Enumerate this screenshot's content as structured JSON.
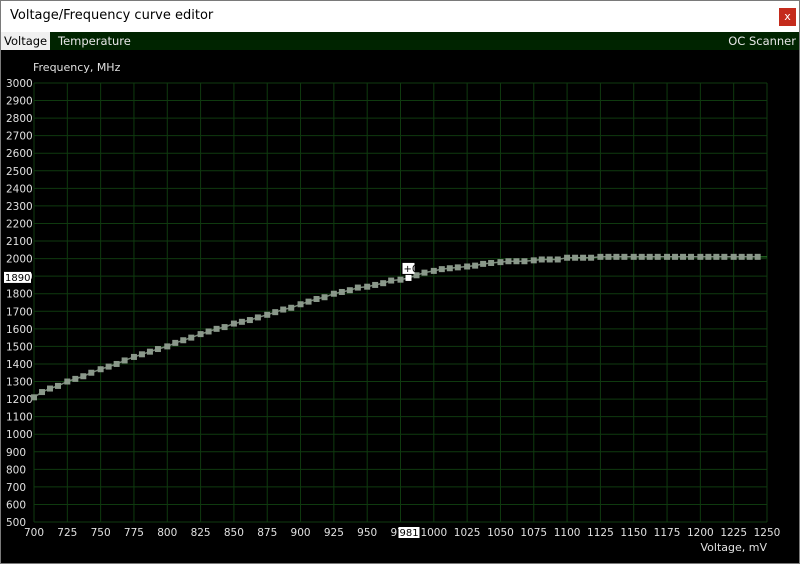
{
  "window": {
    "title": "Voltage/Frequency curve editor",
    "close_label": "x"
  },
  "tabs": [
    {
      "label": "Voltage",
      "active": true
    },
    {
      "label": "Temperature",
      "active": false
    }
  ],
  "scanner_label": "OC Scanner",
  "colors": {
    "background": "#000000",
    "grid": "#0f3a0f",
    "curve": "#7a8a7a",
    "points": "#8a988a",
    "selected": "#ffffff",
    "tab_bar": "#002400"
  },
  "chart_data": {
    "type": "line",
    "ylabel": "Frequency, MHz",
    "xlabel": "Voltage, mV",
    "xlim": [
      700,
      1250
    ],
    "ylim": [
      500,
      3000
    ],
    "x_ticks": [
      700,
      725,
      750,
      775,
      800,
      825,
      850,
      875,
      900,
      925,
      950,
      975,
      1000,
      1025,
      1050,
      1075,
      1100,
      1125,
      1150,
      1175,
      1200,
      1225,
      1250
    ],
    "y_ticks": [
      500,
      600,
      700,
      800,
      900,
      1000,
      1100,
      1200,
      1300,
      1400,
      1500,
      1600,
      1700,
      1800,
      1900,
      2000,
      2100,
      2200,
      2300,
      2400,
      2500,
      2600,
      2700,
      2800,
      2900,
      3000
    ],
    "grid": true,
    "series": [
      {
        "x": [
          700,
          706,
          712,
          718,
          725,
          731,
          737,
          743,
          750,
          756,
          762,
          768,
          775,
          781,
          787,
          793,
          800,
          806,
          812,
          818,
          825,
          831,
          837,
          843,
          850,
          856,
          862,
          868,
          875,
          881,
          887,
          893,
          900,
          906,
          912,
          918,
          925,
          931,
          937,
          943,
          950,
          956,
          962,
          968,
          975,
          981,
          987,
          993,
          1000,
          1006,
          1012,
          1018,
          1025,
          1031,
          1037,
          1043,
          1050,
          1056,
          1062,
          1068,
          1075,
          1081,
          1087,
          1093,
          1100,
          1106,
          1112,
          1118,
          1125,
          1131,
          1137,
          1143,
          1150,
          1156,
          1162,
          1168,
          1175,
          1181,
          1187,
          1193,
          1200,
          1206,
          1212,
          1218,
          1225,
          1231,
          1237,
          1243
        ],
        "y": [
          1210,
          1240,
          1260,
          1275,
          1300,
          1315,
          1330,
          1350,
          1370,
          1385,
          1400,
          1420,
          1440,
          1455,
          1470,
          1485,
          1500,
          1520,
          1535,
          1550,
          1570,
          1585,
          1600,
          1610,
          1630,
          1640,
          1650,
          1665,
          1680,
          1695,
          1710,
          1720,
          1740,
          1755,
          1770,
          1780,
          1800,
          1810,
          1820,
          1835,
          1840,
          1850,
          1860,
          1875,
          1880,
          1890,
          1905,
          1920,
          1930,
          1940,
          1945,
          1950,
          1955,
          1960,
          1970,
          1975,
          1980,
          1985,
          1985,
          1985,
          1990,
          1995,
          1995,
          1995,
          2005,
          2005,
          2005,
          2005,
          2010,
          2010,
          2010,
          2010,
          2010,
          2010,
          2010,
          2010,
          2010,
          2010,
          2010,
          2010,
          2010,
          2010,
          2010,
          2010,
          2010,
          2010,
          2010,
          2010
        ]
      }
    ],
    "selected_point": {
      "x": 981,
      "y": 1890,
      "offset_label": "+0",
      "x_readout": "981",
      "y_readout": "1890"
    }
  }
}
